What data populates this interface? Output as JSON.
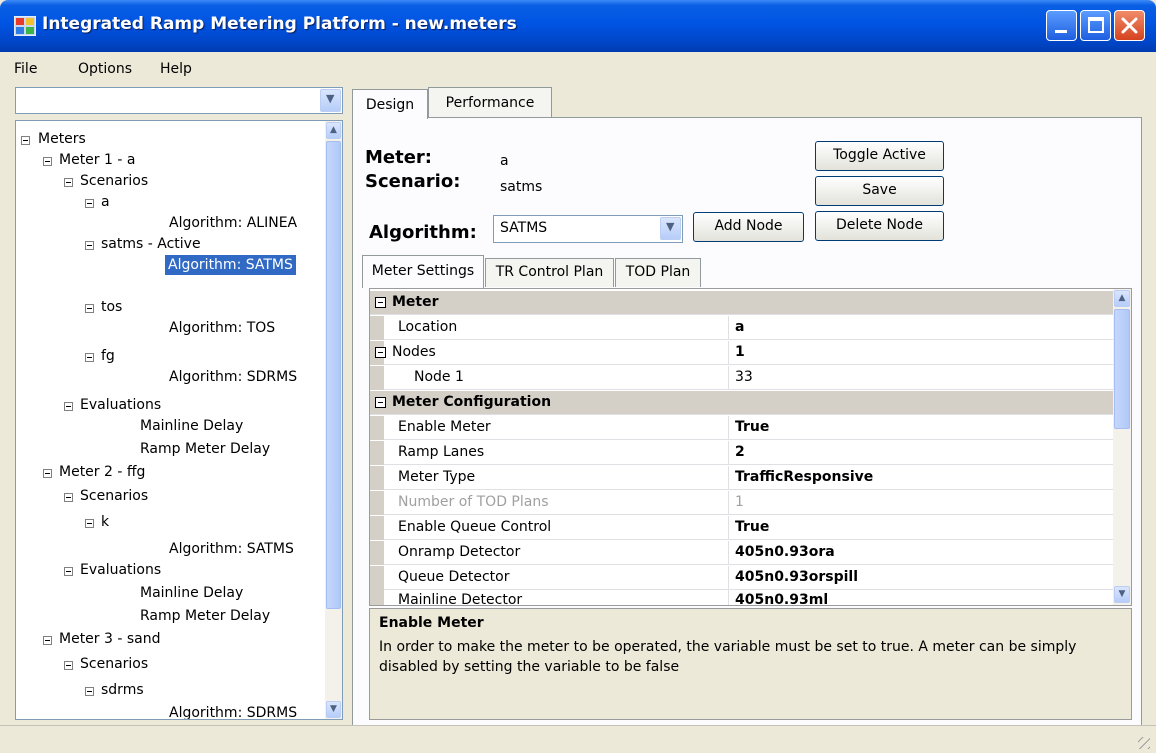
{
  "window": {
    "title": "Integrated Ramp Metering Platform - new.meters"
  },
  "menu": {
    "items": [
      "File",
      "Options",
      "Help"
    ]
  },
  "left": {
    "combo_value": "",
    "tree": [
      "Meters",
      "Meter 1 - a",
      "Scenarios",
      "a",
      "Algorithm: ALINEA",
      "satms - Active",
      "Algorithm: SATMS",
      "tos",
      "Algorithm: TOS",
      "fg",
      "Algorithm: SDRMS",
      "Evaluations",
      "Mainline Delay",
      "Ramp Meter Delay",
      "Meter 2 - ffg",
      "Scenarios",
      "k",
      "Algorithm: SATMS",
      "Evaluations",
      "Mainline Delay",
      "Ramp Meter Delay",
      "Meter 3 - sand",
      "Scenarios",
      "sdrms",
      "Algorithm: SDRMS"
    ]
  },
  "tabs": {
    "design": "Design",
    "performance": "Performance"
  },
  "design": {
    "meter_label": "Meter:",
    "meter_value": "a",
    "scenario_label": "Scenario:",
    "scenario_value": "satms",
    "algorithm_label": "Algorithm:",
    "algorithm_value": "SATMS",
    "buttons": {
      "toggle_active": "Toggle Active",
      "save": "Save",
      "delete_node": "Delete Node",
      "add_node": "Add Node"
    },
    "subtabs": {
      "meter_settings": "Meter Settings",
      "tr_control_plan": "TR Control Plan",
      "tod_plan": "TOD Plan"
    }
  },
  "grid": {
    "rows": [
      {
        "name": "Meter",
        "value": ""
      },
      {
        "name": "Location",
        "value": "a"
      },
      {
        "name": "Nodes",
        "value": "1"
      },
      {
        "name": "Node 1",
        "value": "33"
      },
      {
        "name": "Meter Configuration",
        "value": ""
      },
      {
        "name": "Enable Meter",
        "value": "True"
      },
      {
        "name": "Ramp Lanes",
        "value": "2"
      },
      {
        "name": "Meter Type",
        "value": "TrafficResponsive"
      },
      {
        "name": "Number of TOD Plans",
        "value": "1"
      },
      {
        "name": "Enable Queue Control",
        "value": "True"
      },
      {
        "name": "Onramp Detector",
        "value": "405n0.93ora"
      },
      {
        "name": "Queue Detector",
        "value": "405n0.93orspill"
      },
      {
        "name": "Mainline Detector",
        "value": "405n0.93ml"
      }
    ]
  },
  "help": {
    "title": "Enable Meter",
    "text": "In order to make the meter to be operated, the variable must be set to true. A meter can be simply disabled by setting the variable to be false"
  },
  "colors": {
    "title_bar": "#0054e3",
    "selection": "#316ac5",
    "window_bg": "#ece9d8"
  }
}
